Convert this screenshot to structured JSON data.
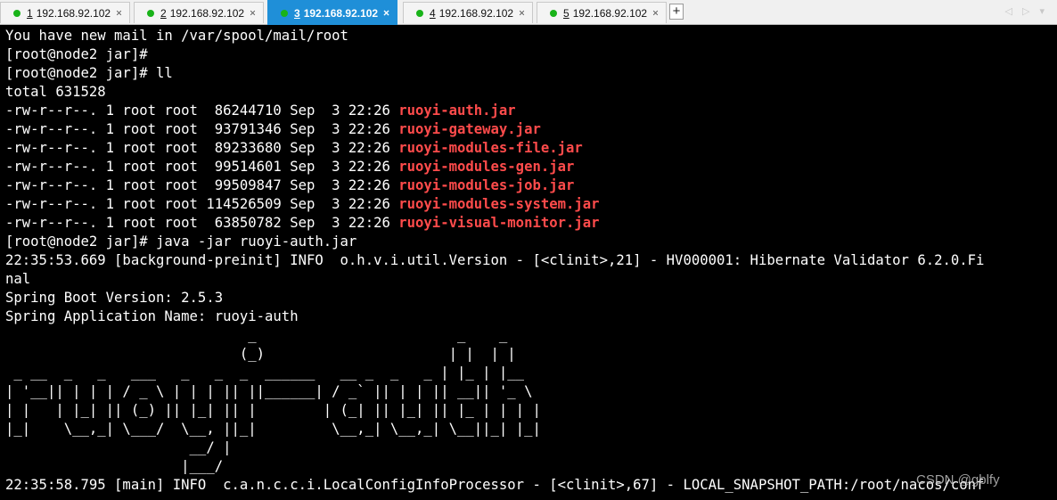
{
  "tabs": [
    {
      "num": "1",
      "label": "192.168.92.102",
      "close": "×"
    },
    {
      "num": "2",
      "label": "192.168.92.102",
      "close": "×"
    },
    {
      "num": "3",
      "label": "192.168.92.102",
      "close": "×",
      "active": true
    },
    {
      "num": "4",
      "label": "192.168.92.102",
      "close": "×"
    },
    {
      "num": "5",
      "label": "192.168.92.102",
      "close": "×"
    }
  ],
  "add_tab": "+",
  "nav_icons": "◁ ▷ ▾",
  "colors": {
    "status_dot": "#19b319",
    "active_tab": "#1f8fd8",
    "filename": "#ff4b4b"
  },
  "terminal": {
    "lines": [
      "You have new mail in /var/spool/mail/root",
      "[root@node2 jar]#",
      "[root@node2 jar]# ll",
      "total 631528"
    ],
    "files": [
      {
        "meta": "-rw-r--r--. 1 root root  86244710 Sep  3 22:26 ",
        "name": "ruoyi-auth.jar"
      },
      {
        "meta": "-rw-r--r--. 1 root root  93791346 Sep  3 22:26 ",
        "name": "ruoyi-gateway.jar"
      },
      {
        "meta": "-rw-r--r--. 1 root root  89233680 Sep  3 22:26 ",
        "name": "ruoyi-modules-file.jar"
      },
      {
        "meta": "-rw-r--r--. 1 root root  99514601 Sep  3 22:26 ",
        "name": "ruoyi-modules-gen.jar"
      },
      {
        "meta": "-rw-r--r--. 1 root root  99509847 Sep  3 22:26 ",
        "name": "ruoyi-modules-job.jar"
      },
      {
        "meta": "-rw-r--r--. 1 root root 114526509 Sep  3 22:26 ",
        "name": "ruoyi-modules-system.jar"
      },
      {
        "meta": "-rw-r--r--. 1 root root  63850782 Sep  3 22:26 ",
        "name": "ruoyi-visual-monitor.jar"
      }
    ],
    "after": [
      "[root@node2 jar]# java -jar ruoyi-auth.jar",
      "22:35:53.669 [background-preinit] INFO  o.h.v.i.util.Version - [<clinit>,21] - HV000001: Hibernate Validator 6.2.0.Fi",
      "nal",
      "Spring Boot Version: 2.5.3",
      "Spring Application Name: ruoyi-auth"
    ],
    "banner": [
      "                             _                        _    _",
      "                            (_)                      | |  | |",
      " _ __  _   _   ___   _   _  _  ______   __ _  _   _ | |_ | |__",
      "| '__|| | | | / _ \\ | | | || ||______| / _` || | | || __|| '_ \\",
      "| |   | |_| || (_) || |_| || |        | (_| || |_| || |_ | | | |",
      "|_|    \\__,_| \\___/  \\__, ||_|         \\__,_| \\__,_| \\__||_| |_|",
      "                      __/ |",
      "                     |___/"
    ],
    "last": "22:35:58.795 [main] INFO  c.a.n.c.c.i.LocalConfigInfoProcessor - [<clinit>,67] - LOCAL_SNAPSHOT_PATH:/root/nacos/conf"
  },
  "watermark": "CSDN @gblfy"
}
